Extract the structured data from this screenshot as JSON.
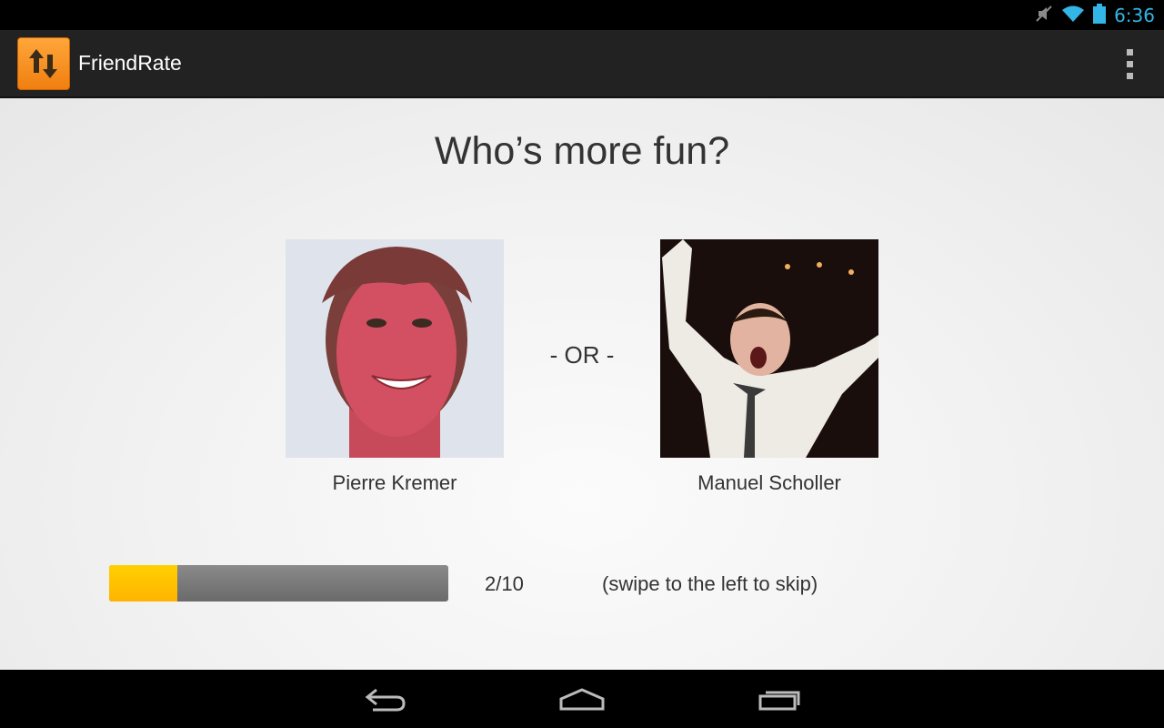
{
  "status_bar": {
    "time": "6:36",
    "icons": [
      "mute-icon",
      "wifi-icon",
      "battery-icon"
    ],
    "accent_color": "#33b5e5"
  },
  "action_bar": {
    "title": "FriendRate",
    "logo_icon": "up-down-arrows-icon",
    "menu_icon": "overflow-menu-icon"
  },
  "main": {
    "question": "Who’s more fun?",
    "separator": "- OR -",
    "friends": [
      {
        "name": "Pierre Kremer"
      },
      {
        "name": "Manuel Scholler"
      }
    ],
    "progress": {
      "current": 2,
      "total": 10,
      "fraction": 0.2,
      "text": "2/10",
      "color": "#ffb400"
    },
    "hint": "(swipe to the left to skip)"
  },
  "nav_bar": {
    "buttons": [
      "back-icon",
      "home-icon",
      "recent-apps-icon"
    ]
  }
}
